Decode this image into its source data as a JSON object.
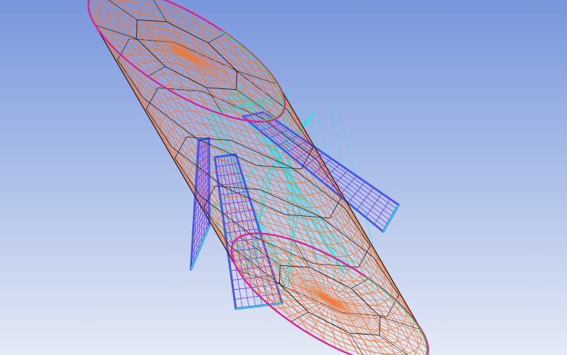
{
  "viewer": {
    "background_top": "#7896dc",
    "background_bottom": "#e4eaf6"
  },
  "model": {
    "shape": "cylinder-with-three-tapered-tubes",
    "tube_count": 3,
    "colors": {
      "shell_mesh": "#f07838",
      "outline": "#1a1a1a",
      "cap_rim": "#e0208c",
      "rim_highlight": "#48d848",
      "tube_mesh": "#7a3cf0",
      "tube_outline": "#4a58e8",
      "flow_lines": "#1ee8e8"
    }
  }
}
